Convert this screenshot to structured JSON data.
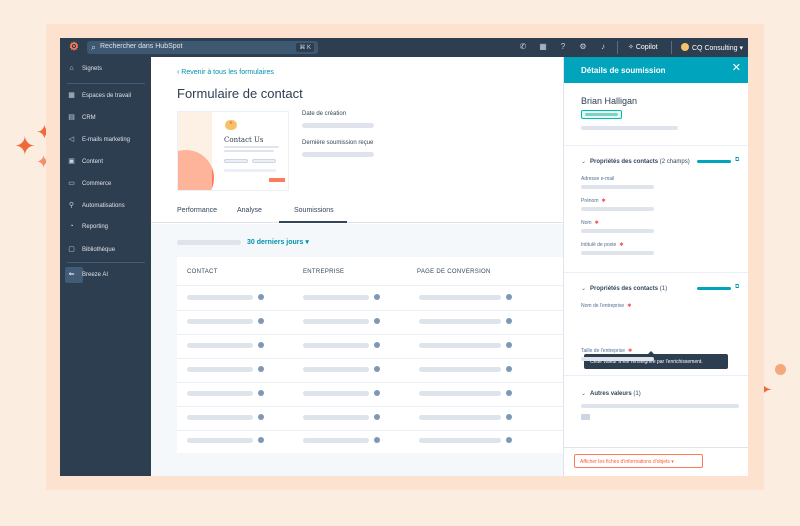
{
  "topbar": {
    "search_placeholder": "Rechercher dans HubSpot",
    "search_shortcut": "⌘ K",
    "copilot_label": "Copilot",
    "account_label": "CQ Consulting ▾"
  },
  "sidebar": {
    "items": [
      {
        "icon": "bookmark-icon",
        "label": "Signets"
      },
      {
        "icon": "workspace-icon",
        "label": "Espaces de travail"
      },
      {
        "icon": "crm-icon",
        "label": "CRM"
      },
      {
        "icon": "marketing-icon",
        "label": "E-mails marketing"
      },
      {
        "icon": "content-icon",
        "label": "Content"
      },
      {
        "icon": "commerce-icon",
        "label": "Commerce"
      },
      {
        "icon": "automation-icon",
        "label": "Automatisations"
      },
      {
        "icon": "reporting-icon",
        "label": "Reporting"
      },
      {
        "icon": "library-icon",
        "label": "Bibliothèque"
      },
      {
        "icon": "breeze-icon",
        "label": "Breeze AI"
      }
    ]
  },
  "main": {
    "back_link": "Revenir à tous les formulaires",
    "title": "Formulaire de contact",
    "thumb_heading": "Contact Us",
    "meta": {
      "created_label": "Date de création",
      "last_submission_label": "Dernière soumission reçue"
    },
    "tabs": [
      "Performance",
      "Analyse",
      "Soumissions"
    ],
    "filter_label": "30 derniers jours ▾",
    "columns": [
      "CONTACT",
      "ENTREPRISE",
      "PAGE DE CONVERSION"
    ]
  },
  "panel": {
    "title": "Détails de soumission",
    "contact_name": "Brian Halligan",
    "section1": {
      "title": "Propriétés des contacts",
      "count": "(2 champs)"
    },
    "section1_fields": [
      {
        "label": "Adresse e-mail",
        "required": false
      },
      {
        "label": "Prénom",
        "required": true
      },
      {
        "label": "Nom",
        "required": true
      },
      {
        "label": "Intitulé de poste",
        "required": true
      }
    ],
    "section2": {
      "title": "Propriétés des contacts",
      "count": "(1)"
    },
    "section2_fields": [
      {
        "label": "Nom de l'entreprise",
        "required": true
      },
      {
        "label": "Taille de l'entreprise",
        "required": true
      }
    ],
    "tooltip": "Cette valeur a été renseignée par l'enrichissement.",
    "section3": {
      "title": "Autres valeurs",
      "count": "(1)"
    },
    "footer_button": "Afficher les fiches d'informations d'objets ▾"
  },
  "colors": {
    "accent": "#00a4bd",
    "nav_bg": "#2d3e50",
    "cta": "#ff7a59",
    "link": "#0091ae",
    "required": "#f2545b"
  }
}
